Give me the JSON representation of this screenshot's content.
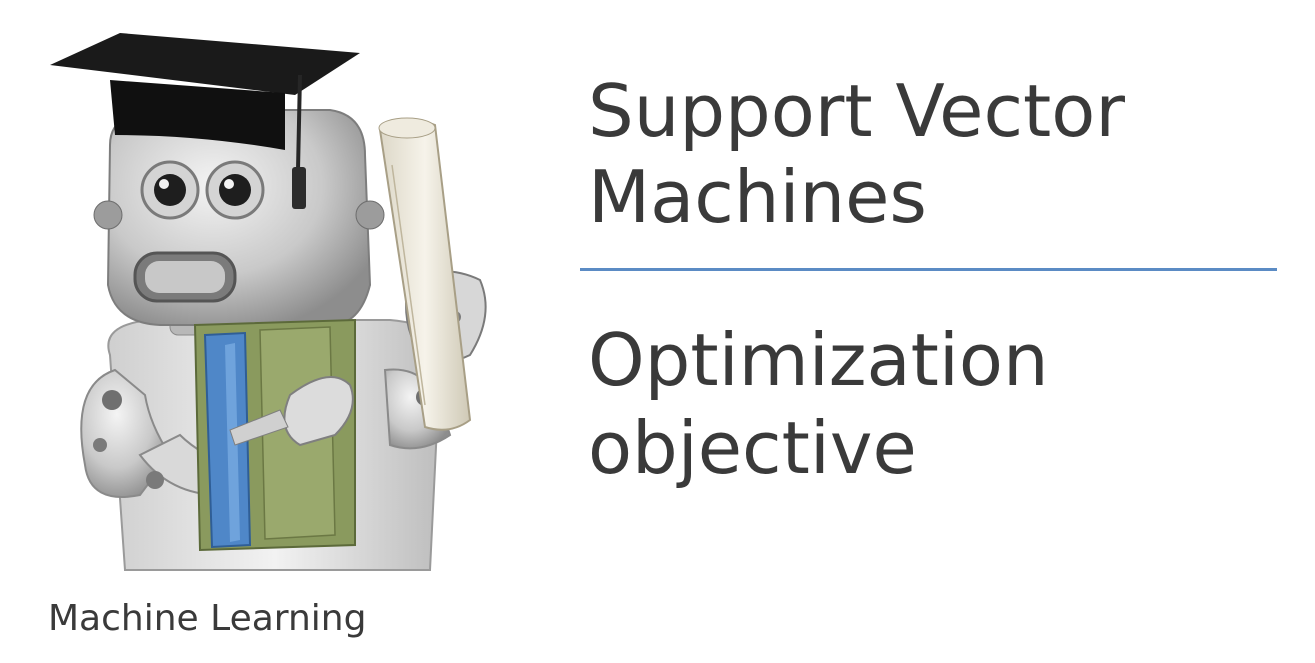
{
  "slide": {
    "title_line1": "Support Vector",
    "title_line2": "Machines",
    "subtitle_line1": "Optimization",
    "subtitle_line2": "objective",
    "course_name": "Machine Learning",
    "mascot_icon": "graduate-robot-icon",
    "accent_color": "#5b8bc4",
    "text_color": "#3a3a3a"
  }
}
